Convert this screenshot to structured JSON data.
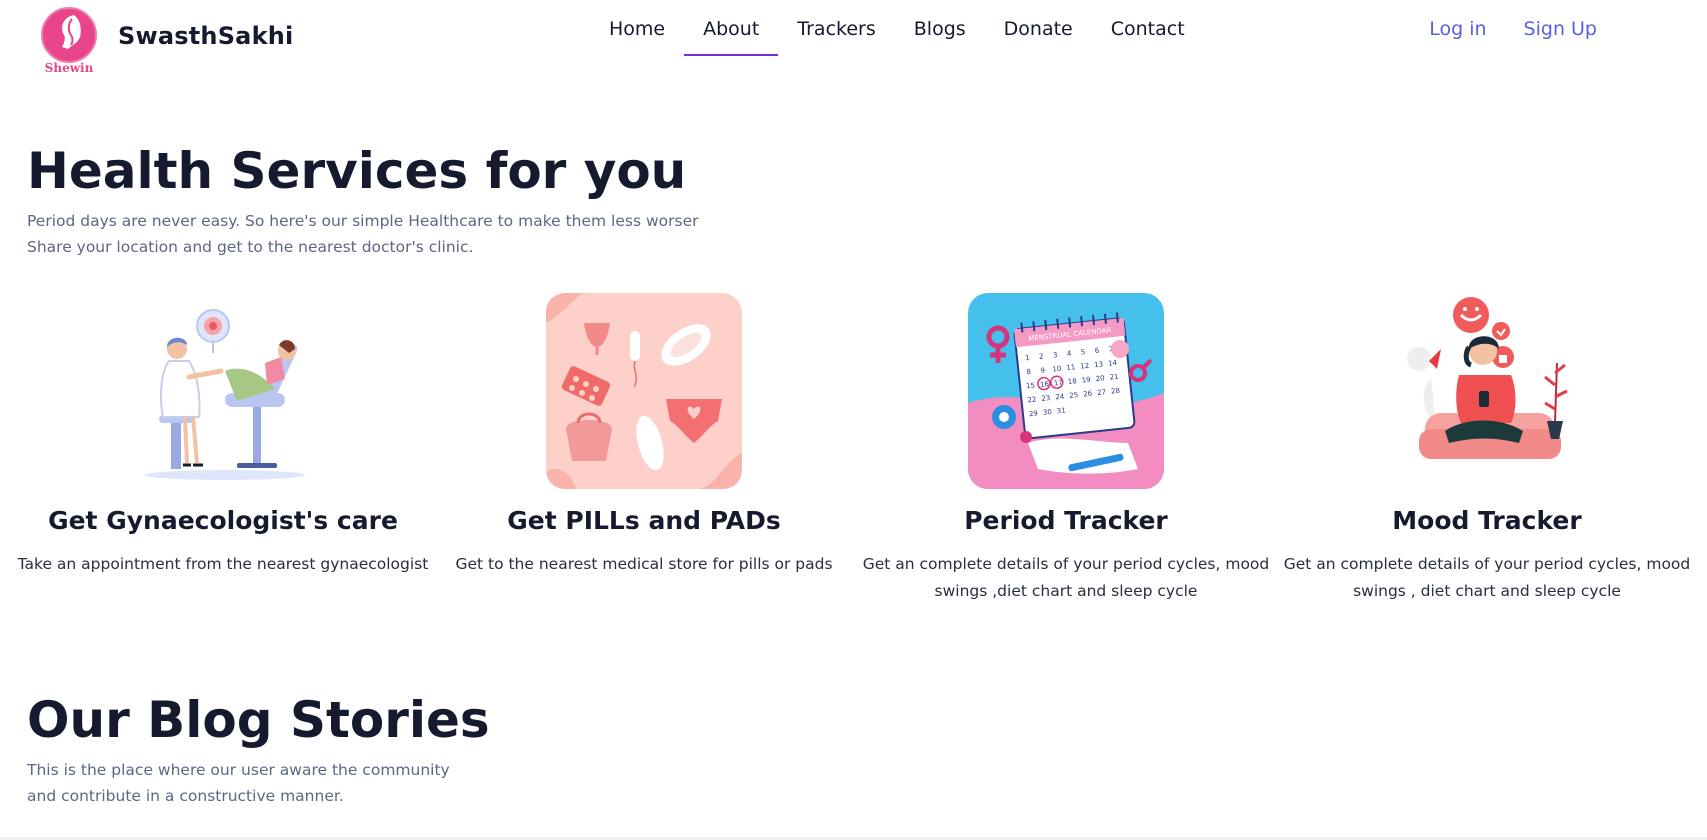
{
  "header": {
    "logo_caption": "Shewin",
    "brand": "SwasthSakhi",
    "nav": [
      {
        "label": "Home"
      },
      {
        "label": "About"
      },
      {
        "label": "Trackers"
      },
      {
        "label": "Blogs"
      },
      {
        "label": "Donate"
      },
      {
        "label": "Contact"
      }
    ],
    "active_nav": "About",
    "login": "Log in",
    "signup": "Sign Up",
    "colors": {
      "accent_link": "#5a5fe0",
      "active_underline": "#7a2ed9",
      "logo_pink": "#e8458b"
    }
  },
  "services": {
    "title": "Health Services for you",
    "line1": "Period days are never easy. So here's our simple Healthcare to make them less worser",
    "line2": "Share your location and get to the nearest doctor's clinic.",
    "cards": [
      {
        "title": "Get Gynaecologist's care",
        "desc": "Take an appointment from the nearest gynaecologist",
        "icon": "gynaecologist-illustration"
      },
      {
        "title": "Get PILLs and PADs",
        "desc": "Get to the nearest medical store for pills or pads",
        "icon": "pills-pads-illustration"
      },
      {
        "title": "Period Tracker",
        "desc": "Get an complete details of your period cycles, mood swings ,diet chart and sleep cycle",
        "icon": "menstrual-calendar-illustration",
        "calendar_label": "MENSTRUAL CALENDAR"
      },
      {
        "title": "Mood Tracker",
        "desc": "Get an complete details of your period cycles, mood swings , diet chart and sleep cycle",
        "icon": "mood-illustration"
      }
    ]
  },
  "blog": {
    "title": "Our Blog Stories",
    "line1": "This is the place where our user aware the community",
    "line2": "and contribute in a constructive manner."
  }
}
